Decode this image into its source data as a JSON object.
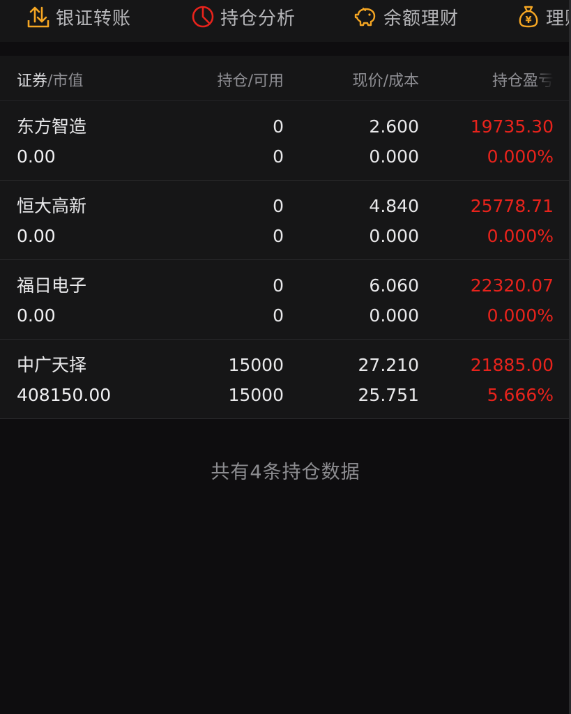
{
  "toolbar": {
    "items": [
      {
        "label": "银证转账",
        "icon": "transfer-icon",
        "color": "#f5a623"
      },
      {
        "label": "持仓分析",
        "icon": "pie-chart-icon",
        "color": "#e8231c"
      },
      {
        "label": "余额理财",
        "icon": "piggy-bank-icon",
        "color": "#f5a623"
      },
      {
        "label": "理财",
        "icon": "money-bag-icon",
        "color": "#f5a623"
      }
    ]
  },
  "table": {
    "headers": {
      "security": {
        "main": "证券",
        "sep": "/",
        "sub": "市值"
      },
      "position": {
        "main": "持仓",
        "sep": "/",
        "sub": "可用"
      },
      "price": {
        "main": "现价",
        "sep": "/",
        "sub": "成本"
      },
      "pnl": {
        "main": "持仓盈亏"
      }
    },
    "rows": [
      {
        "name": "东方智造",
        "market_value": "0.00",
        "holding": "0",
        "available": "0",
        "price": "2.600",
        "cost": "0.000",
        "pnl": "19735.30",
        "pnl_pct": "0.000%"
      },
      {
        "name": "恒大高新",
        "market_value": "0.00",
        "holding": "0",
        "available": "0",
        "price": "4.840",
        "cost": "0.000",
        "pnl": "25778.71",
        "pnl_pct": "0.000%"
      },
      {
        "name": "福日电子",
        "market_value": "0.00",
        "holding": "0",
        "available": "0",
        "price": "6.060",
        "cost": "0.000",
        "pnl": "22320.07",
        "pnl_pct": "0.000%"
      },
      {
        "name": "中广天择",
        "market_value": "408150.00",
        "holding": "15000",
        "available": "15000",
        "price": "27.210",
        "cost": "25.751",
        "pnl": "21885.00",
        "pnl_pct": "5.666%"
      }
    ]
  },
  "footer": {
    "text": "共有4条持仓数据"
  },
  "colors": {
    "accent_orange": "#f5a623",
    "profit_red": "#e8231c"
  }
}
